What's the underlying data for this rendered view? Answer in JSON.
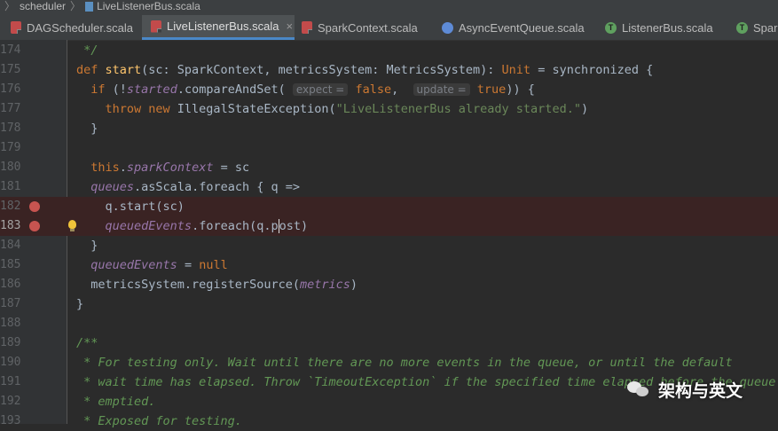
{
  "breadcrumb": {
    "items": [
      "scheduler",
      "LiveListenerBus.scala"
    ]
  },
  "tabs": [
    {
      "label": "DAGScheduler.scala",
      "icon": "scala-file-icon",
      "active": false
    },
    {
      "label": "LiveListenerBus.scala",
      "icon": "scala-file-icon",
      "active": true,
      "close": "×"
    },
    {
      "label": "SparkContext.scala",
      "icon": "scala-file-icon",
      "active": false
    },
    {
      "label": "AsyncEventQueue.scala",
      "icon": "class-icon",
      "active": false
    },
    {
      "label": "ListenerBus.scala",
      "icon": "trait-icon",
      "active": false
    },
    {
      "label": "Spar",
      "icon": "trait-icon",
      "active": false
    }
  ],
  "editor": {
    "lines": [
      {
        "num": "174",
        "text": " */"
      },
      {
        "num": "175",
        "text": "def start(sc: SparkContext, metricsSystem: MetricsSystem): Unit = synchronized {"
      },
      {
        "num": "176",
        "text": "  if (!started.compareAndSet( expect = false,  update = true)) {"
      },
      {
        "num": "177",
        "text": "    throw new IllegalStateException(\"LiveListenerBus already started.\")"
      },
      {
        "num": "178",
        "text": "  }"
      },
      {
        "num": "179",
        "text": ""
      },
      {
        "num": "180",
        "text": "  this.sparkContext = sc"
      },
      {
        "num": "181",
        "text": "  queues.asScala.foreach { q =>"
      },
      {
        "num": "182",
        "text": "    q.start(sc)",
        "breakpoint": true
      },
      {
        "num": "183",
        "text": "    queuedEvents.foreach(q.post)",
        "breakpoint": true
      },
      {
        "num": "184",
        "text": "  }"
      },
      {
        "num": "185",
        "text": "  queuedEvents = null"
      },
      {
        "num": "186",
        "text": "  metricsSystem.registerSource(metrics)"
      },
      {
        "num": "187",
        "text": "}"
      },
      {
        "num": "188",
        "text": ""
      },
      {
        "num": "189",
        "text": "/**"
      },
      {
        "num": "190",
        "text": " * For testing only. Wait until there are no more events in the queue, or until the default"
      },
      {
        "num": "191",
        "text": " * wait time has elapsed. Throw `TimeoutException` if the specified time elapsed before the queue"
      },
      {
        "num": "192",
        "text": " * emptied."
      },
      {
        "num": "193",
        "text": " * Exposed for testing."
      }
    ]
  },
  "watermark": {
    "text": "架构与英文",
    "icon": "wechat-icon"
  },
  "colors": {
    "background": "#2b2b2b",
    "keyword": "#cc7832",
    "string": "#6a8759",
    "comment": "#629755",
    "field": "#9876aa",
    "breakpoint": "#c75450",
    "active_tab": "#4a88c7"
  }
}
